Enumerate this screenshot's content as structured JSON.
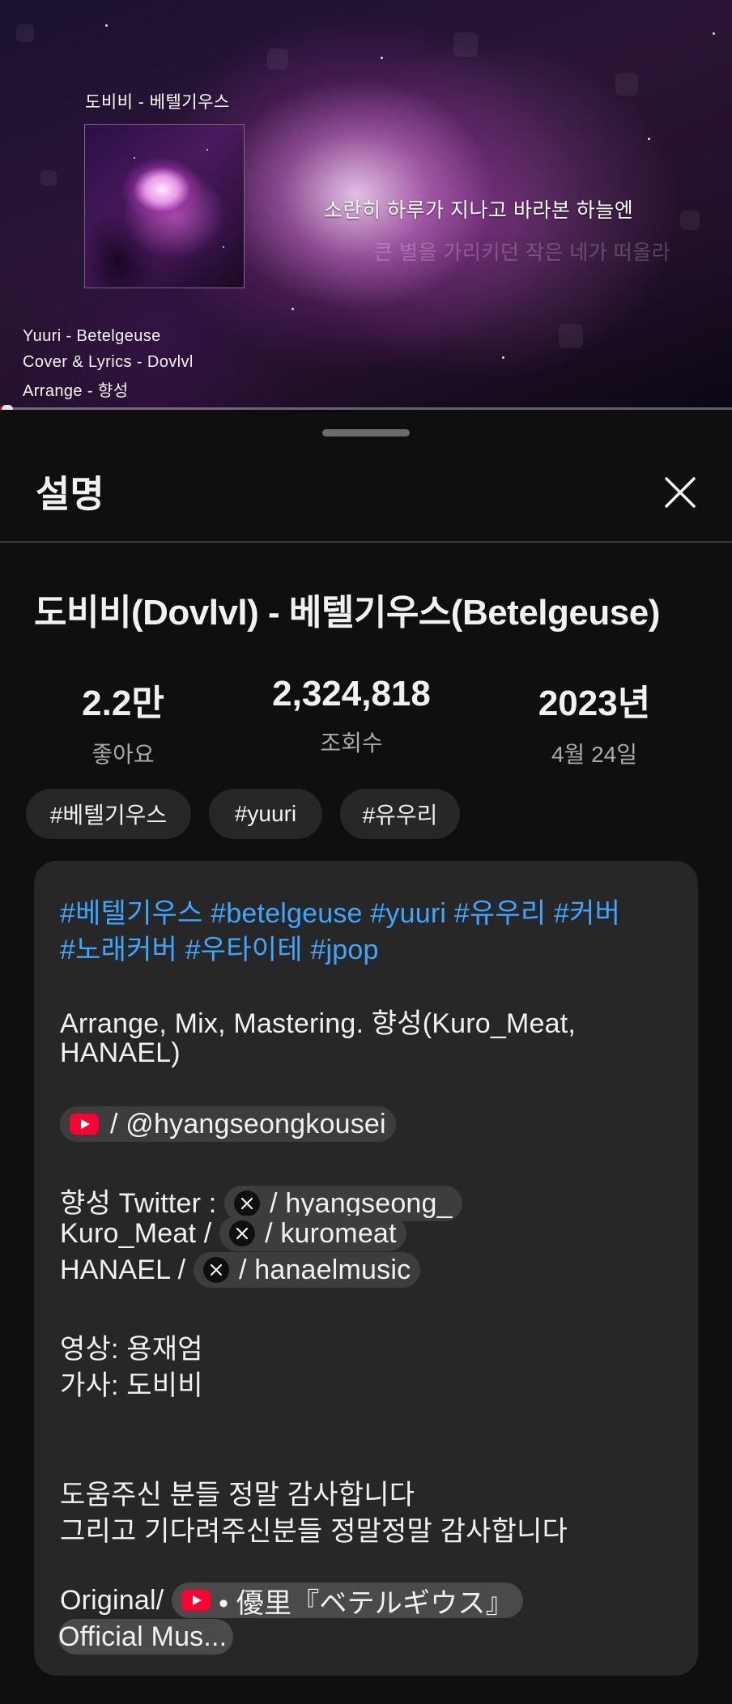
{
  "video": {
    "overlay_title": "도비비 - 베텔기우스",
    "lyric_line_1": "소란히 하루가 지나고 바라본 하늘엔",
    "lyric_line_2": "큰 별을 가리키던 작은 네가 떠올라",
    "credit_1": "Yuuri - Betelgeuse",
    "credit_2": "Cover & Lyrics - Dovlvl",
    "credit_3": "Arrange - 향성",
    "progress_fraction": 0.01
  },
  "sheet": {
    "title": "설명",
    "close_icon": "close-icon",
    "video_title": "도비비(Dovlvl) - 베텔기우스(Betelgeuse)",
    "stats": [
      {
        "value": "2.2만",
        "label": "좋아요"
      },
      {
        "value": "2,324,818",
        "label": "조회수"
      },
      {
        "value": "2023년",
        "label": "4월 24일"
      }
    ],
    "chips": [
      "#베텔기우스",
      "#yuuri",
      "#유우리"
    ]
  },
  "description": {
    "hashtags_line_1": [
      "#베텔기우스",
      "#betelgeuse",
      "#yuuri",
      "#유우리",
      "#커버"
    ],
    "hashtags_line_2": [
      "#노래커버",
      "#우타이테",
      "#jpop"
    ],
    "credits_line_1": "Arrange, Mix, Mastering. 향성(Kuro_Meat,",
    "credits_line_2": "HANAEL)",
    "youtube_link": "/ @hyangseongkousei",
    "twitter_1_prefix": "향성 Twitter : ",
    "twitter_1_link": "/ hyangseong_",
    "twitter_2_prefix": "Kuro_Meat / ",
    "twitter_2_link": "/ kuromeat",
    "twitter_3_prefix": "HANAEL / ",
    "twitter_3_link": "/ hanaelmusic",
    "video_credit": "영상: 용재엄",
    "lyrics_credit": "가사: 도비비",
    "thanks_1": "도움주신 분들 정말 감사합니다",
    "thanks_2": "그리고 기다려주신분들 정말정말 감사합니다",
    "original_prefix": "Original/ ",
    "original_link_1": "• 優里『ベテルギウス』",
    "original_link_2": "Official Mus..."
  },
  "icons": {
    "youtube": "youtube-icon",
    "x": "x-icon"
  },
  "colors": {
    "background": "#0f0f0f",
    "card": "#272727",
    "hashtag": "#3ea6ff",
    "youtube_red": "#ff0033"
  }
}
